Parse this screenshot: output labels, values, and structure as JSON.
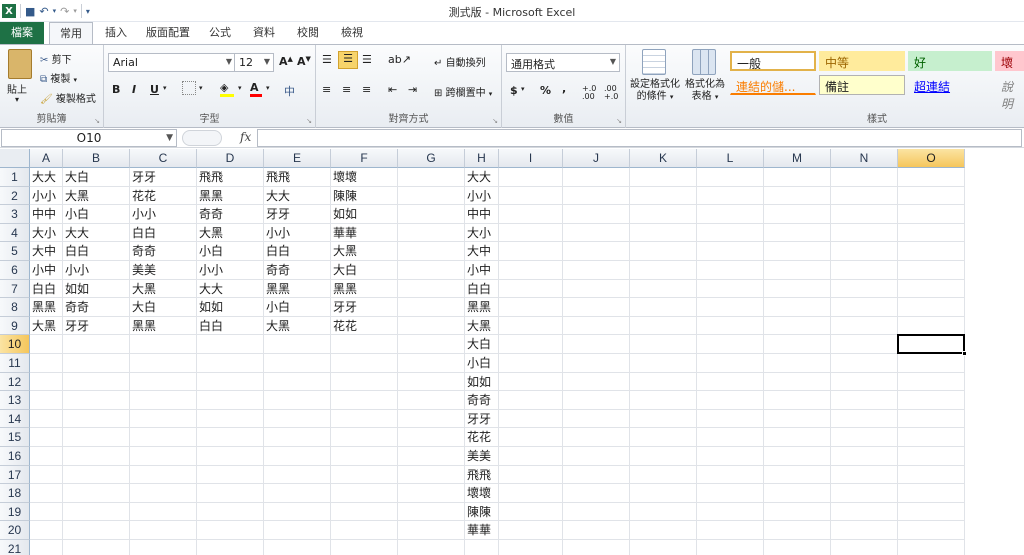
{
  "window": {
    "title": "測式版 - Microsoft Excel"
  },
  "tabs": [
    "檔案",
    "常用",
    "插入",
    "版面配置",
    "公式",
    "資料",
    "校閱",
    "檢視"
  ],
  "ribbon": {
    "clipboard": {
      "paste": "貼上",
      "cut": "剪下",
      "copy": "複製",
      "format_painter": "複製格式",
      "label": "剪貼簿"
    },
    "font": {
      "name": "Arial",
      "size": "12",
      "bold": "B",
      "italic": "I",
      "underline": "U",
      "label": "字型",
      "grow": "A",
      "shrink": "A",
      "font_color": "A",
      "phonetic": "中"
    },
    "alignment": {
      "wrap": "自動換列",
      "merge": "跨欄置中",
      "label": "對齊方式"
    },
    "number": {
      "format": "通用格式",
      "label": "數值",
      "currency": "$",
      "percent": "%",
      "comma": ",",
      "inc_decimal": "+.0 .00",
      "dec_decimal": ".00 +.0"
    },
    "styles": {
      "conditional": [
        "設定格式化",
        "的條件"
      ],
      "as_table": [
        "格式化為",
        "表格"
      ],
      "label": "樣式",
      "cells": [
        {
          "text": "一般",
          "bg": "#ffffff",
          "color": "#000000",
          "border": "#c9a33a"
        },
        {
          "text": "中等",
          "bg": "#ffeb9c",
          "color": "#9c6500",
          "border": "transparent"
        },
        {
          "text": "好",
          "bg": "#c6efce",
          "color": "#006100",
          "border": "transparent"
        },
        {
          "text": "壞",
          "bg": "#ffc7ce",
          "color": "#9c0006",
          "border": "transparent"
        },
        {
          "text": "連結的儲...",
          "bg": "#ffffff",
          "color": "#fa7d00",
          "border": "transparent"
        },
        {
          "text": "備註",
          "bg": "#ffffcc",
          "color": "#000000",
          "border": "#b2b2b2"
        },
        {
          "text": "超連結",
          "bg": "#ffffff",
          "color": "#0000ff",
          "border": "transparent"
        },
        {
          "text": "說明",
          "bg": "#ffffff",
          "color": "#7f7f7f",
          "border": "transparent"
        }
      ]
    }
  },
  "formula_bar": {
    "name_box": "O10",
    "fx": "fx",
    "value": ""
  },
  "sheet": {
    "columns": [
      "A",
      "B",
      "C",
      "D",
      "E",
      "F",
      "G",
      "H",
      "I",
      "J",
      "K",
      "L",
      "M",
      "N",
      "O"
    ],
    "selected_column": "O",
    "selected_row": 10,
    "row_count": 21,
    "data": {
      "A": [
        "大大",
        "小小",
        "中中",
        "大小",
        "大中",
        "小中",
        "白白",
        "黑黑",
        "大黑"
      ],
      "B": [
        "大白",
        "大黑",
        "小白",
        "大大",
        "白白",
        "小小",
        "如如",
        "奇奇",
        "牙牙"
      ],
      "C": [
        "牙牙",
        "花花",
        "小小",
        "白白",
        "奇奇",
        "美美",
        "大黑",
        "大白",
        "黑黑"
      ],
      "D": [
        "飛飛",
        "黑黑",
        "奇奇",
        "大黑",
        "小白",
        "小小",
        "大大",
        "如如",
        "白白"
      ],
      "E": [
        "飛飛",
        "大大",
        "牙牙",
        "小小",
        "白白",
        "奇奇",
        "黑黑",
        "小白",
        "大黑"
      ],
      "F": [
        "壞壞",
        "陳陳",
        "如如",
        "華華",
        "大黑",
        "大白",
        "黑黑",
        "牙牙",
        "花花"
      ],
      "H": [
        "大大",
        "小小",
        "中中",
        "大小",
        "大中",
        "小中",
        "白白",
        "黑黑",
        "大黑",
        "大白",
        "小白",
        "如如",
        "奇奇",
        "牙牙",
        "花花",
        "美美",
        "飛飛",
        "壞壞",
        "陳陳",
        "華華"
      ]
    }
  },
  "colors": {
    "file_tab": "#1e7145",
    "selection_header": "#f5c65c"
  }
}
